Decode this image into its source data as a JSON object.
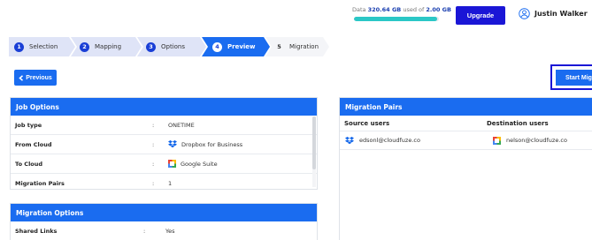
{
  "header": {
    "data_prefix": "Data",
    "data_used": "320.64 GB",
    "data_mid": "used of",
    "data_total": "2.00 GB",
    "usage_fraction": 0.98,
    "upgrade_label": "Upgrade",
    "user_name": "Justin Walker"
  },
  "stepper": {
    "steps": [
      {
        "num": "1",
        "label": "Selection",
        "state": "done"
      },
      {
        "num": "2",
        "label": "Mapping",
        "state": "done"
      },
      {
        "num": "3",
        "label": "Options",
        "state": "done"
      },
      {
        "num": "4",
        "label": "Preview",
        "state": "active"
      },
      {
        "num": "5",
        "label": "Migration",
        "state": "pending"
      }
    ]
  },
  "actions": {
    "previous_label": "Previous",
    "start_label": "Start Migration"
  },
  "job_options": {
    "title": "Job Options",
    "rows": [
      {
        "key": "Job type",
        "value": "ONETIME"
      },
      {
        "key": "From Cloud",
        "value": "Dropbox for Business",
        "icon": "dropbox-icon"
      },
      {
        "key": "To Cloud",
        "value": "Google Suite",
        "icon": "google-icon"
      },
      {
        "key": "Migration Pairs",
        "value": "1"
      }
    ]
  },
  "migration_options": {
    "title": "Migration Options",
    "rows": [
      {
        "key": "Shared Links",
        "value": "Yes"
      }
    ]
  },
  "migration_pairs": {
    "title": "Migration Pairs",
    "col_source": "Source users",
    "col_destination": "Destination users",
    "rows": [
      {
        "source": "edsonl@cloudfuze.co",
        "destination": "nelson@cloudfuze.co"
      }
    ]
  },
  "colors": {
    "primary": "#1a6cf0",
    "upgrade": "#1a16d6",
    "usage_bar": "#2bc7c6"
  }
}
